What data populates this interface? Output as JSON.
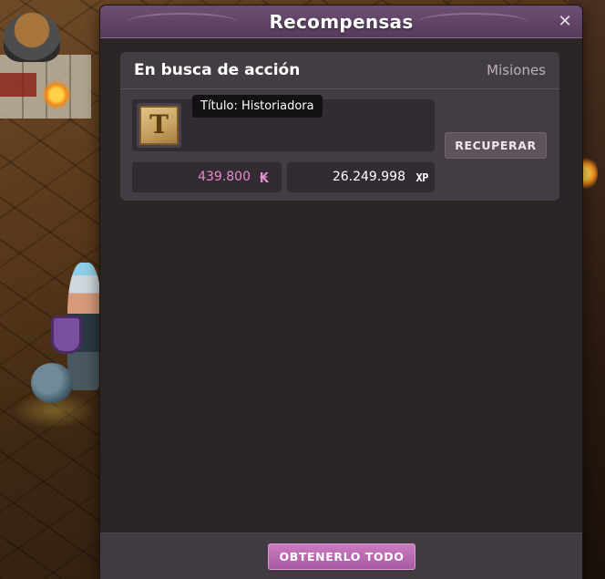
{
  "window": {
    "title": "Recompensas",
    "close_symbol": "✕"
  },
  "quest": {
    "name": "En busca de acción",
    "category": "Misiones",
    "reward_icon": "title-scroll-icon",
    "reward_icon_letter": "T",
    "tooltip": "Título: Historiadora",
    "recover_label": "RECUPERAR",
    "kamas": "439.800",
    "kamas_symbol": "₭",
    "xp": "26.249.998",
    "xp_symbol": "XP"
  },
  "footer": {
    "get_all_label": "OBTENERLO TODO"
  },
  "colors": {
    "accent": "#b865ae",
    "kamas": "#e58ccf",
    "title_bar": "#604565"
  }
}
